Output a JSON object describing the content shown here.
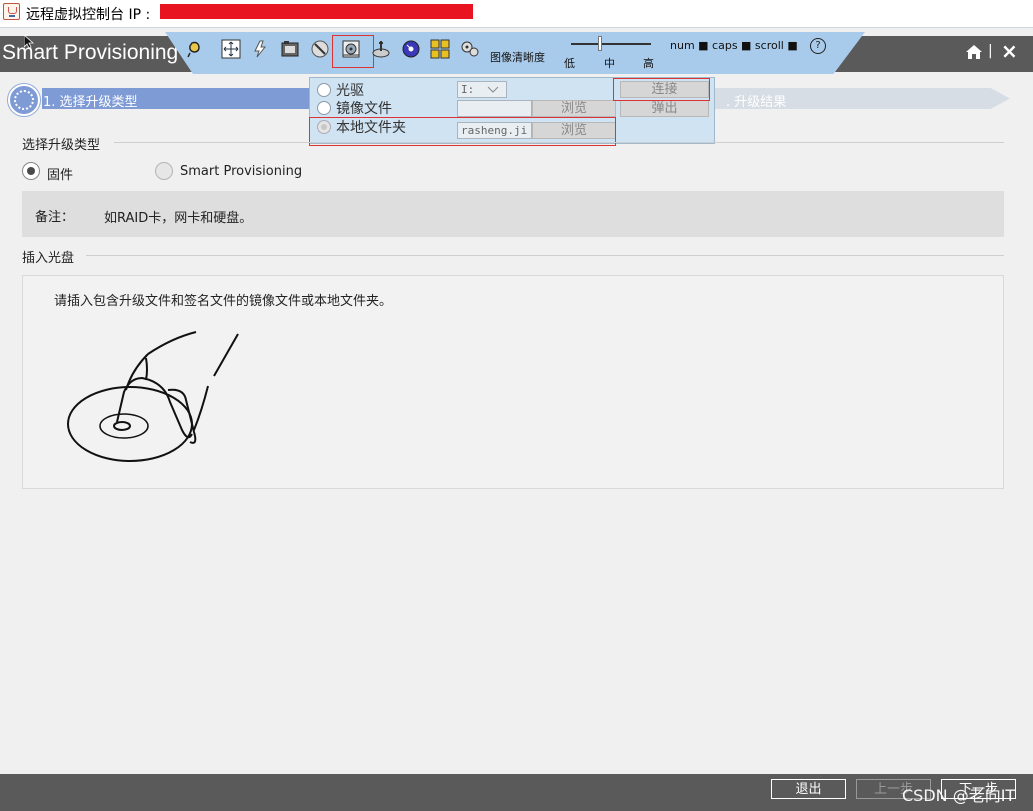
{
  "window": {
    "title": "远程虚拟控制台   IP :"
  },
  "app": {
    "name": "Smart Provisioning"
  },
  "toolbar": {
    "icons": [
      "mouse-icon",
      "move-icon",
      "flash-icon",
      "film-icon",
      "tool-icon",
      "floppy-disc-icon",
      "disc-hand-icon",
      "cd-icon",
      "text-layout-icon",
      "gears-icon"
    ],
    "quality_label": "图像清晰度",
    "quality_low": "低",
    "quality_mid": "中",
    "quality_high": "高",
    "keyboard_status": "num ■ caps ■ scroll ■"
  },
  "header_right": {
    "separator": "|"
  },
  "steps": {
    "step1": "1. 选择升级类型",
    "step3": ". 升级结果"
  },
  "media_popup": {
    "optical_label": "光驱",
    "image_label": "镜像文件",
    "local_folder_label": "本地文件夹",
    "drive_value": "I:",
    "image_path": "",
    "folder_path": "rasheng.ji",
    "browse1": "浏览",
    "browse2": "浏览",
    "connect": "连接",
    "eject": "弹出"
  },
  "upgrade_type": {
    "title": "选择升级类型",
    "option_firmware": "固件",
    "option_sp": "Smart Provisioning",
    "selected": "固件"
  },
  "note": {
    "label": "备注：",
    "text": "如RAID卡，网卡和硬盘。"
  },
  "insert_disc": {
    "title": "插入光盘",
    "instruction": "请插入包含升级文件和签名文件的镜像文件或本地文件夹。"
  },
  "footer": {
    "exit": "退出",
    "prev": "上一步",
    "next": "下一步",
    "watermark": "CSDN @老向IT"
  },
  "colors": {
    "accent": "#7e9bd6",
    "toolbar": "#a9cbeb",
    "header": "#5a5a5a",
    "redaction": "#e8141f",
    "highlight": "#dd3333"
  }
}
